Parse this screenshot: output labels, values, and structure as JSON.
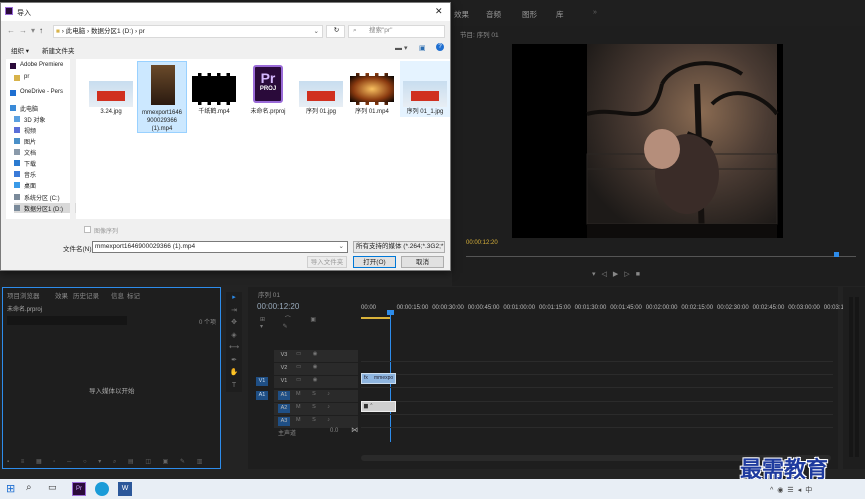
{
  "premiere": {
    "workspace_tabs": [
      "效果",
      "音频",
      "图形",
      "库"
    ],
    "program_tab": "节目: 序列 01",
    "program_timecode": "00:00:12:20",
    "project_panel": {
      "tabs": [
        "项目浏览器",
        "效果",
        "历史记录",
        "信息",
        "标记"
      ],
      "project_name": "未命名.prproj",
      "item_count": "0 个项",
      "hint": "导入媒体以开始"
    },
    "timeline": {
      "tab": "序列 01",
      "timecode": "00:00:12:20",
      "ruler": [
        "00:00",
        "00:00:15:00",
        "00:00:30:00",
        "00:00:45:00",
        "00:01:00:00",
        "00:01:15:00",
        "00:01:30:00",
        "00:01:45:00",
        "00:02:00:00",
        "00:02:15:00",
        "00:02:30:00",
        "00:02:45:00",
        "00:03:00:00",
        "00:03:15"
      ],
      "tracks_video": [
        "V3",
        "V2",
        "V1"
      ],
      "tracks_audio": [
        "A1",
        "A2",
        "A3"
      ],
      "source_video": "V1",
      "source_audio": "A1",
      "master_label": "主声道",
      "master_value": "0.0",
      "video_clip": "mmexpo",
      "video_clip_fx": "fx"
    }
  },
  "dialog": {
    "title": "导入",
    "breadcrumb": [
      "此电脑",
      "数据分区1 (D:)",
      "pr"
    ],
    "search_placeholder": "搜索\"pr\"",
    "toolbar": {
      "organize": "组织 ▾",
      "new_folder": "新建文件夹"
    },
    "nav": [
      {
        "label": "Adobe Premiere",
        "icon": "premiere-icon"
      },
      {
        "label": "pr",
        "icon": "folder-icon"
      },
      {
        "label": "OneDrive - Pers",
        "icon": "cloud-icon"
      },
      {
        "label": "此电脑",
        "icon": "computer-icon"
      },
      {
        "label": "3D 对象",
        "icon": "cube-icon"
      },
      {
        "label": "视频",
        "icon": "video-icon"
      },
      {
        "label": "图片",
        "icon": "picture-icon"
      },
      {
        "label": "文档",
        "icon": "document-icon"
      },
      {
        "label": "下载",
        "icon": "download-icon"
      },
      {
        "label": "音乐",
        "icon": "music-icon"
      },
      {
        "label": "桌面",
        "icon": "desktop-icon"
      },
      {
        "label": "系统分区 (C:)",
        "icon": "drive-icon"
      },
      {
        "label": "数据分区1 (D:)",
        "icon": "drive-icon"
      }
    ],
    "files": [
      {
        "name": "3.24.jpg",
        "kind": "jpg"
      },
      {
        "name": "mmexport1646900029366 (1).mp4",
        "kind": "night"
      },
      {
        "name": "千纸鹤.mp4",
        "kind": "film"
      },
      {
        "name": "未命名.prproj",
        "kind": "proj"
      },
      {
        "name": "序列 01.jpg",
        "kind": "jpg"
      },
      {
        "name": "序列 01.mp4",
        "kind": "film-fire"
      },
      {
        "name": "序列 01_1.jpg",
        "kind": "jpg"
      }
    ],
    "files_lines": [
      [
        "3.24.jpg"
      ],
      [
        "mmexport1646",
        "900029366",
        "(1).mp4"
      ],
      [
        "千纸鹤.mp4"
      ],
      [
        "未命名.prproj"
      ],
      [
        "序列 01.jpg"
      ],
      [
        "序列 01.mp4"
      ],
      [
        "序列 01_1.jpg"
      ]
    ],
    "proj_badge_top": "Pr",
    "proj_badge_bottom": "PROJ",
    "sequence_checkbox": "图像序列",
    "filename_label": "文件名(N):",
    "filename_value": "mmexport1646900029366 (1).mp4",
    "filetype_value": "所有支持的媒体 (*.264;*.3G2;*",
    "import_folder": "导入文件夹",
    "open": "打开(O)",
    "cancel": "取消"
  },
  "watermark": "最需教育",
  "colors": {
    "accent": "#2d8ceb",
    "clip_video": "#8fb6e0",
    "dialog_select": "#cce8ff"
  }
}
